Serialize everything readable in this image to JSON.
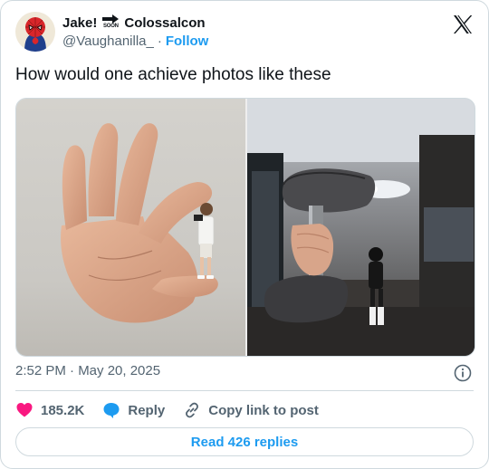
{
  "tweet": {
    "author": {
      "display_name_prefix": "Jake!",
      "soon_label": "SOON",
      "display_name_suffix": "Colossalcon",
      "handle": "@Vaughanilla_",
      "separator": "·",
      "follow_label": "Follow",
      "avatar_icon": "spiderman-avatar"
    },
    "brand_icon": "x-logo-icon",
    "text": "How would one achieve photos like these",
    "media": [
      {
        "icon": "giant-hand-photo"
      },
      {
        "icon": "gym-dumbbell-photo"
      }
    ],
    "timestamp": "2:52 PM · May 20, 2025",
    "actions": {
      "likes": "185.2K",
      "reply_label": "Reply",
      "copy_label": "Copy link to post"
    },
    "read_replies_label": "Read 426 replies"
  },
  "colors": {
    "accent": "#1d9bf0",
    "like": "#f91880",
    "text": "#0f1419",
    "muted": "#536471",
    "border": "#cfd9de"
  }
}
